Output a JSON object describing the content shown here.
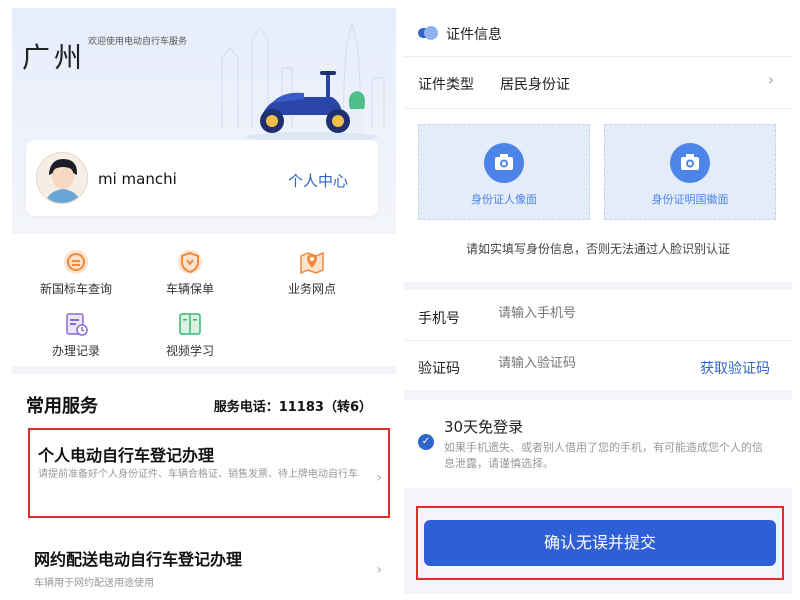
{
  "left": {
    "city": "广州",
    "welcome": "欢迎使用电动自行车服务",
    "profile": {
      "username": "mi manchi",
      "center_label": "个人中心"
    },
    "grid": [
      {
        "label": "新国标车查询",
        "icon": "query-icon"
      },
      {
        "label": "车辆保单",
        "icon": "insurance-shield-icon"
      },
      {
        "label": "业务网点",
        "icon": "map-location-icon"
      },
      {
        "label": "办理记录",
        "icon": "record-clock-icon"
      },
      {
        "label": "视频学习",
        "icon": "book-video-icon"
      }
    ],
    "services": {
      "title": "常用服务",
      "phone": "服务电话：11183（转6）",
      "card1": {
        "title": "个人电动自行车登记办理",
        "desc": "请提前准备好个人身份证件、车辆合格证、销售发票、待上牌电动自行车"
      },
      "card2": {
        "title": "网约配送电动自行车登记办理",
        "desc": "车辆用于网约配送用途使用"
      }
    }
  },
  "right": {
    "id_section_title": "证件信息",
    "id_type_label": "证件类型",
    "id_type_value": "居民身份证",
    "photo_front": "身份证人像面",
    "photo_back": "身份证明国徽面",
    "id_note": "请如实填写身份信息，否则无法通过人脸识别认证",
    "phone_label": "手机号",
    "phone_placeholder": "请输入手机号",
    "code_label": "验证码",
    "code_placeholder": "请输入验证码",
    "get_code": "获取验证码",
    "login_title": "30天免登录",
    "login_desc": "如果手机遗失、或者别人借用了您的手机，有可能造成您个人的信息泄露，请谨慎选择。",
    "submit_label": "确认无误并提交"
  },
  "colors": {
    "accent": "#2f66c9",
    "button": "#2f5fd6",
    "highlight_border": "#e02b2b",
    "icon_orange": "#f08a3c",
    "icon_purple": "#8a6ad8",
    "icon_green": "#3bb56e"
  }
}
